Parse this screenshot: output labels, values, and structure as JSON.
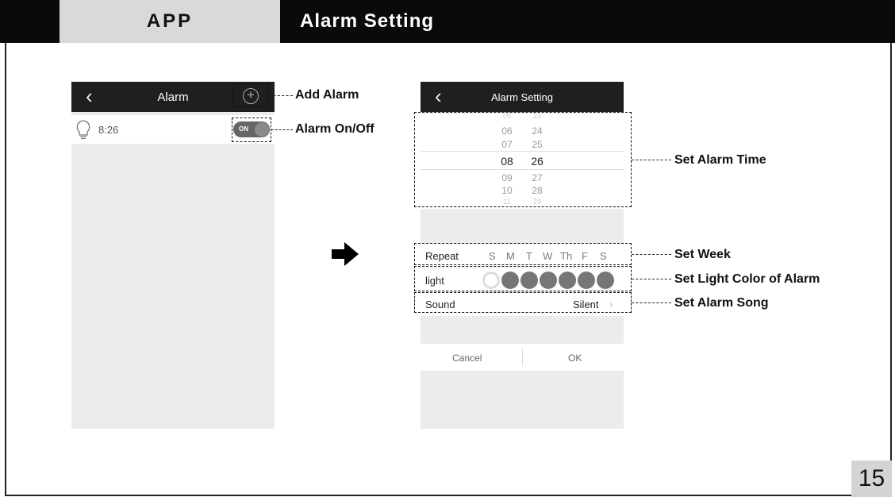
{
  "header": {
    "section": "APP",
    "title": "Alarm Setting"
  },
  "page_number": "15",
  "alarm_screen": {
    "nav_title": "Alarm",
    "alarm_time": "8:26",
    "toggle_label": "ON"
  },
  "callouts": {
    "add_alarm": "Add Alarm",
    "alarm_on_off": "Alarm On/Off",
    "set_alarm_time": "Set Alarm Time",
    "set_week": "Set Week",
    "set_light_color": "Set Light Color of Alarm",
    "set_alarm_song": "Set Alarm Song"
  },
  "setting_screen": {
    "nav_title": "Alarm Setting",
    "picker_rows": [
      {
        "h": "05",
        "m": "23"
      },
      {
        "h": "06",
        "m": "24"
      },
      {
        "h": "07",
        "m": "25"
      },
      {
        "h": "08",
        "m": "26"
      },
      {
        "h": "09",
        "m": "27"
      },
      {
        "h": "10",
        "m": "28"
      },
      {
        "h": "11",
        "m": "29"
      }
    ],
    "repeat_label": "Repeat",
    "days": [
      "S",
      "M",
      "T",
      "W",
      "Th",
      "F",
      "S"
    ],
    "light_label": "light",
    "sound_label": "Sound",
    "sound_value": "Silent",
    "cancel_label": "Cancel",
    "ok_label": "OK"
  }
}
